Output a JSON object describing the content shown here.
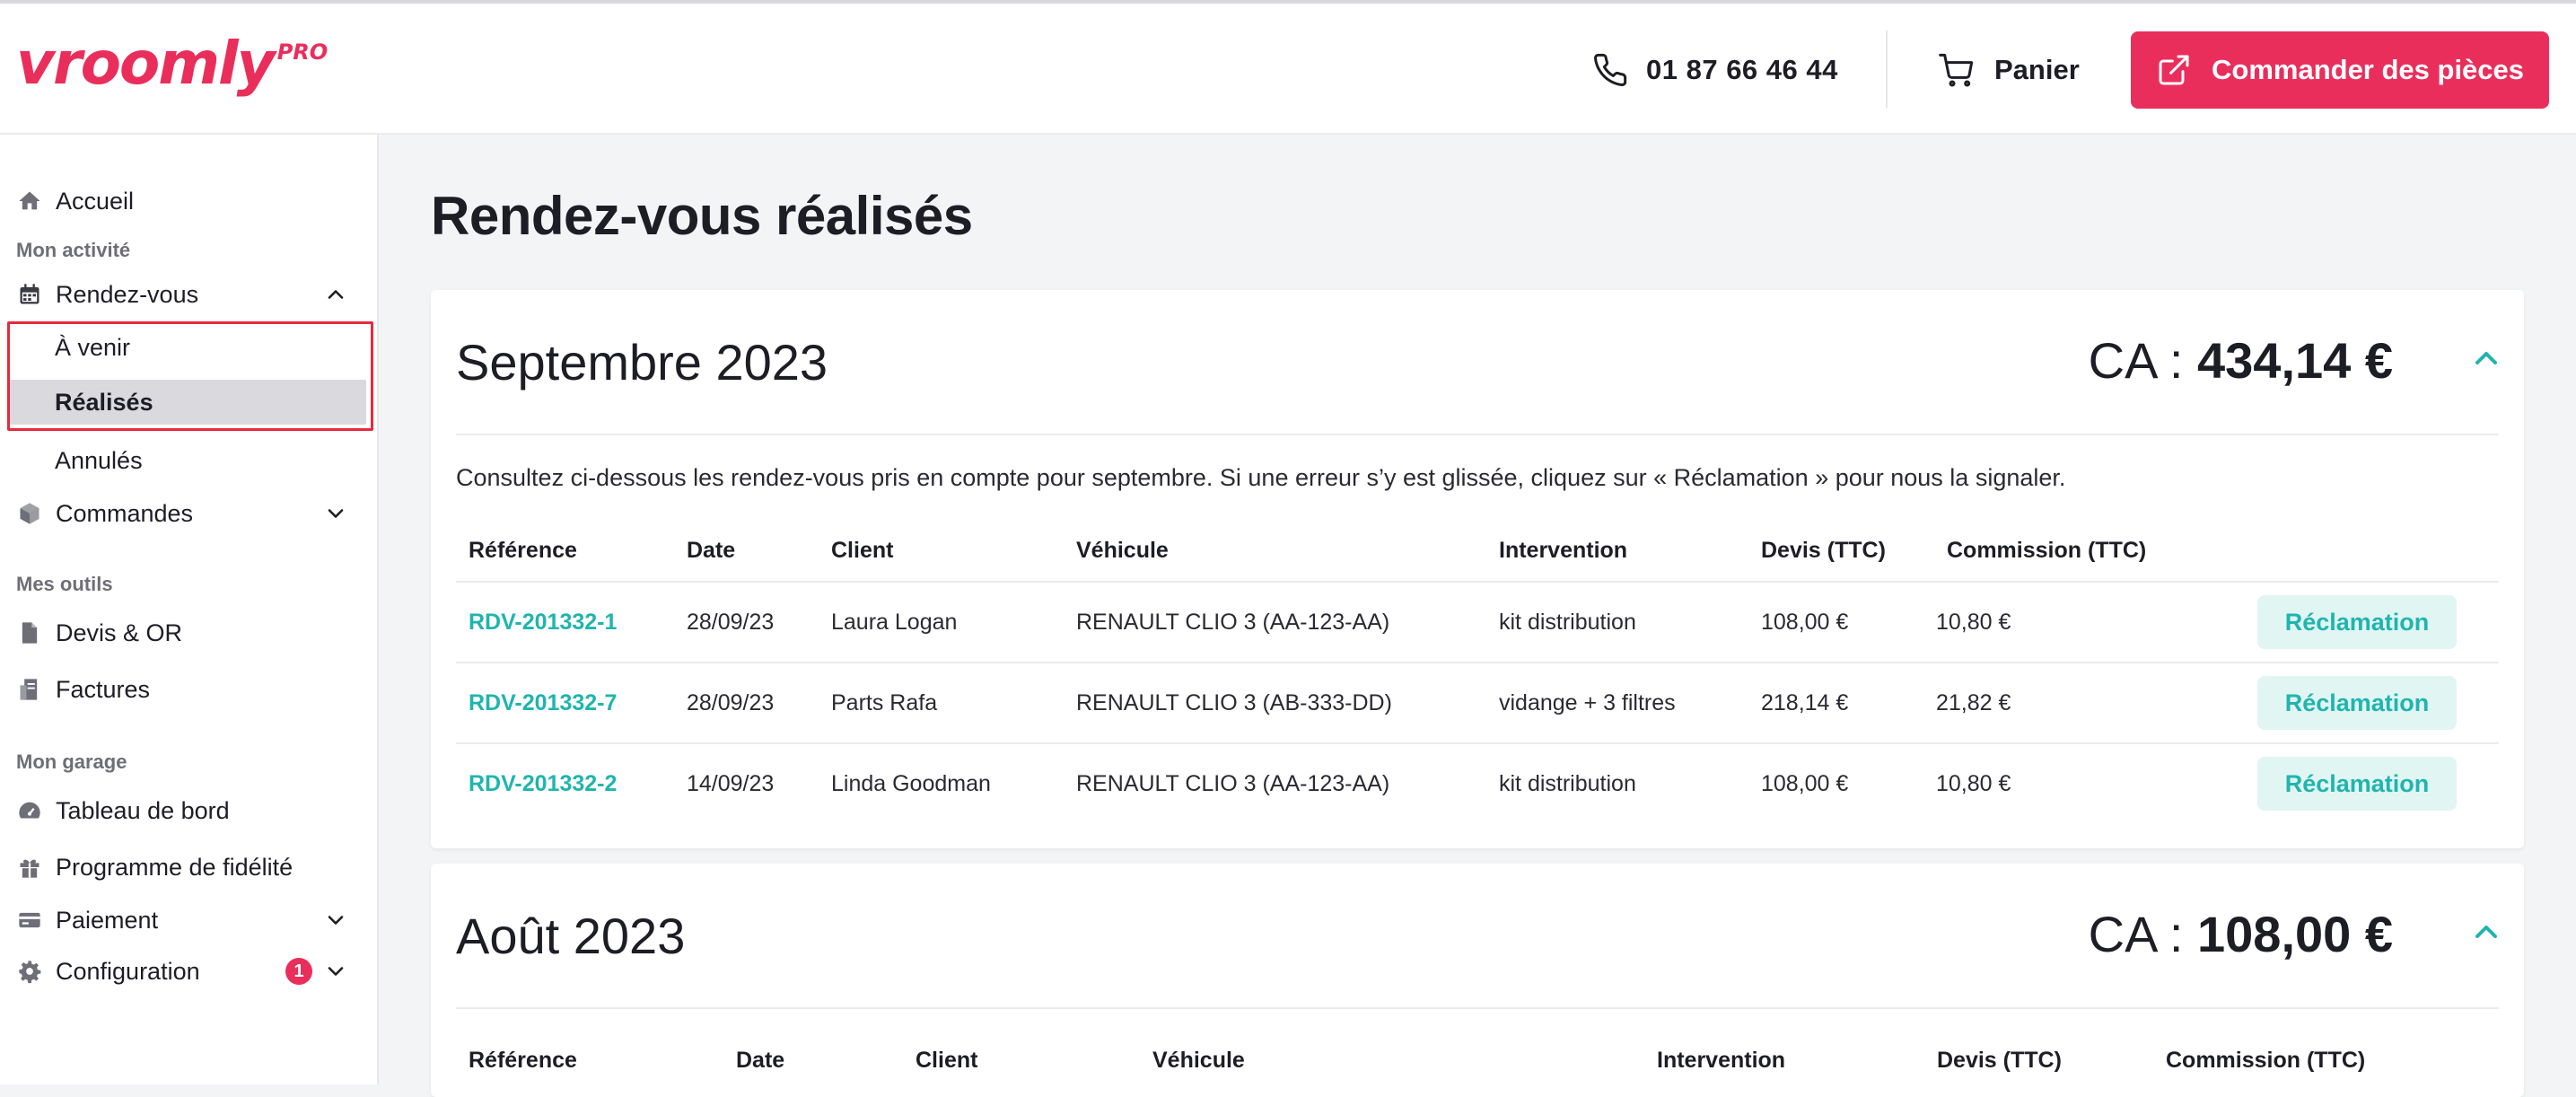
{
  "header": {
    "logo": "vroomly",
    "logo_suffix": "PRO",
    "phone": "01 87 66 46 44",
    "cart_label": "Panier",
    "order_button_label": "Commander des pièces",
    "accent_color": "#ea2e5c",
    "icons": {
      "phone": "phone-icon",
      "cart": "cart-icon",
      "order": "external-link-icon"
    }
  },
  "sidebar": {
    "home": "Accueil",
    "section_activity": "Mon activité",
    "appointments": "Rendez-vous",
    "appointments_sub": [
      "À venir",
      "Réalisés",
      "Annulés"
    ],
    "orders": "Commandes",
    "section_tools": "Mes outils",
    "quotes": "Devis & OR",
    "invoices": "Factures",
    "section_garage": "Mon garage",
    "dashboard": "Tableau de bord",
    "loyalty": "Programme de fidélité",
    "payment": "Paiement",
    "configuration": "Configuration",
    "configuration_badge": "1",
    "active_item": "Réalisés"
  },
  "main": {
    "title": "Rendez-vous réalisés",
    "teal_color": "#1fb5ae",
    "months": [
      {
        "title": "Septembre 2023",
        "ca_prefix": "CA : ",
        "ca_value": "434,14 €",
        "description": "Consultez ci-dessous les rendez-vous pris en compte pour septembre. Si une erreur s’y est glissée, cliquez sur « Réclamation » pour nous la signaler.",
        "columns": [
          "Référence",
          "Date",
          "Client",
          "Véhicule",
          "Intervention",
          "Devis (TTC)",
          "Commission (TTC)"
        ],
        "rows": [
          {
            "ref": "RDV-201332-1",
            "date": "28/09/23",
            "client": "Laura Logan",
            "vehicle": "RENAULT CLIO 3 (AA-123-AA)",
            "intervention": "kit distribution",
            "quote": "108,00 €",
            "commission": "10,80 €",
            "action": "Réclamation"
          },
          {
            "ref": "RDV-201332-7",
            "date": "28/09/23",
            "client": "Parts Rafa",
            "vehicle": "RENAULT CLIO 3 (AB-333-DD)",
            "intervention": "vidange + 3 filtres",
            "quote": "218,14 €",
            "commission": "21,82 €",
            "action": "Réclamation"
          },
          {
            "ref": "RDV-201332-2",
            "date": "14/09/23",
            "client": "Linda Goodman",
            "vehicle": "RENAULT CLIO 3 (AA-123-AA)",
            "intervention": "kit distribution",
            "quote": "108,00 €",
            "commission": "10,80 €",
            "action": "Réclamation"
          }
        ]
      },
      {
        "title": "Août 2023",
        "ca_prefix": "CA : ",
        "ca_value": "108,00 €",
        "columns": [
          "Référence",
          "Date",
          "Client",
          "Véhicule",
          "Intervention",
          "Devis (TTC)",
          "Commission (TTC)"
        ]
      }
    ]
  }
}
